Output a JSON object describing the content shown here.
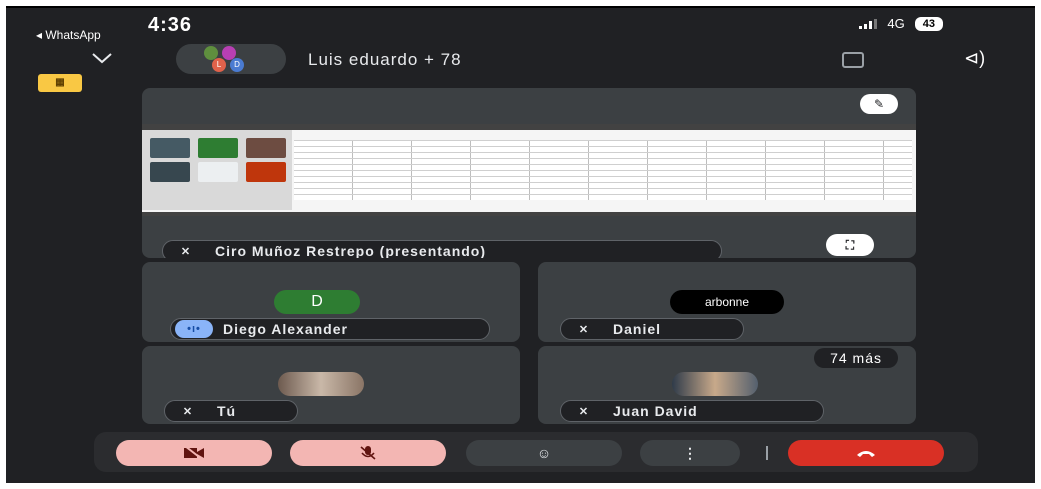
{
  "status": {
    "time": "4:36",
    "back_label": "◂ WhatsApp",
    "network": "4G",
    "battery": "43"
  },
  "header": {
    "title": "Luis eduardo + 78",
    "avatar_initials": [
      "",
      "",
      "L",
      "D"
    ]
  },
  "presentation": {
    "presenter_label": "Ciro Muñoz Restrepo (presentando)"
  },
  "participants": [
    {
      "name": "Diego Alexander",
      "avatar_text": "D",
      "speaking": true
    },
    {
      "name": "Daniel",
      "avatar_text": "arbonne"
    },
    {
      "name": "Tú"
    },
    {
      "name": "Juan David",
      "more_label": "74 más"
    }
  ],
  "controls": {
    "more_glyph": "⋮",
    "react_glyph": "☺"
  },
  "colors": {
    "background": "#202124",
    "tile": "#3c4043",
    "end_call": "#d93025",
    "muted_button": "#f3b6b3",
    "avatar_green": "#2e7d32",
    "speaking_indicator": "#8ab4f8"
  },
  "icons": [
    "chevron-down-icon",
    "camera-switch-icon",
    "speaker-icon",
    "pin-icon",
    "fullscreen-icon",
    "mic-off-icon",
    "camera-off-icon",
    "emoji-icon",
    "more-vert-icon",
    "end-call-icon"
  ]
}
